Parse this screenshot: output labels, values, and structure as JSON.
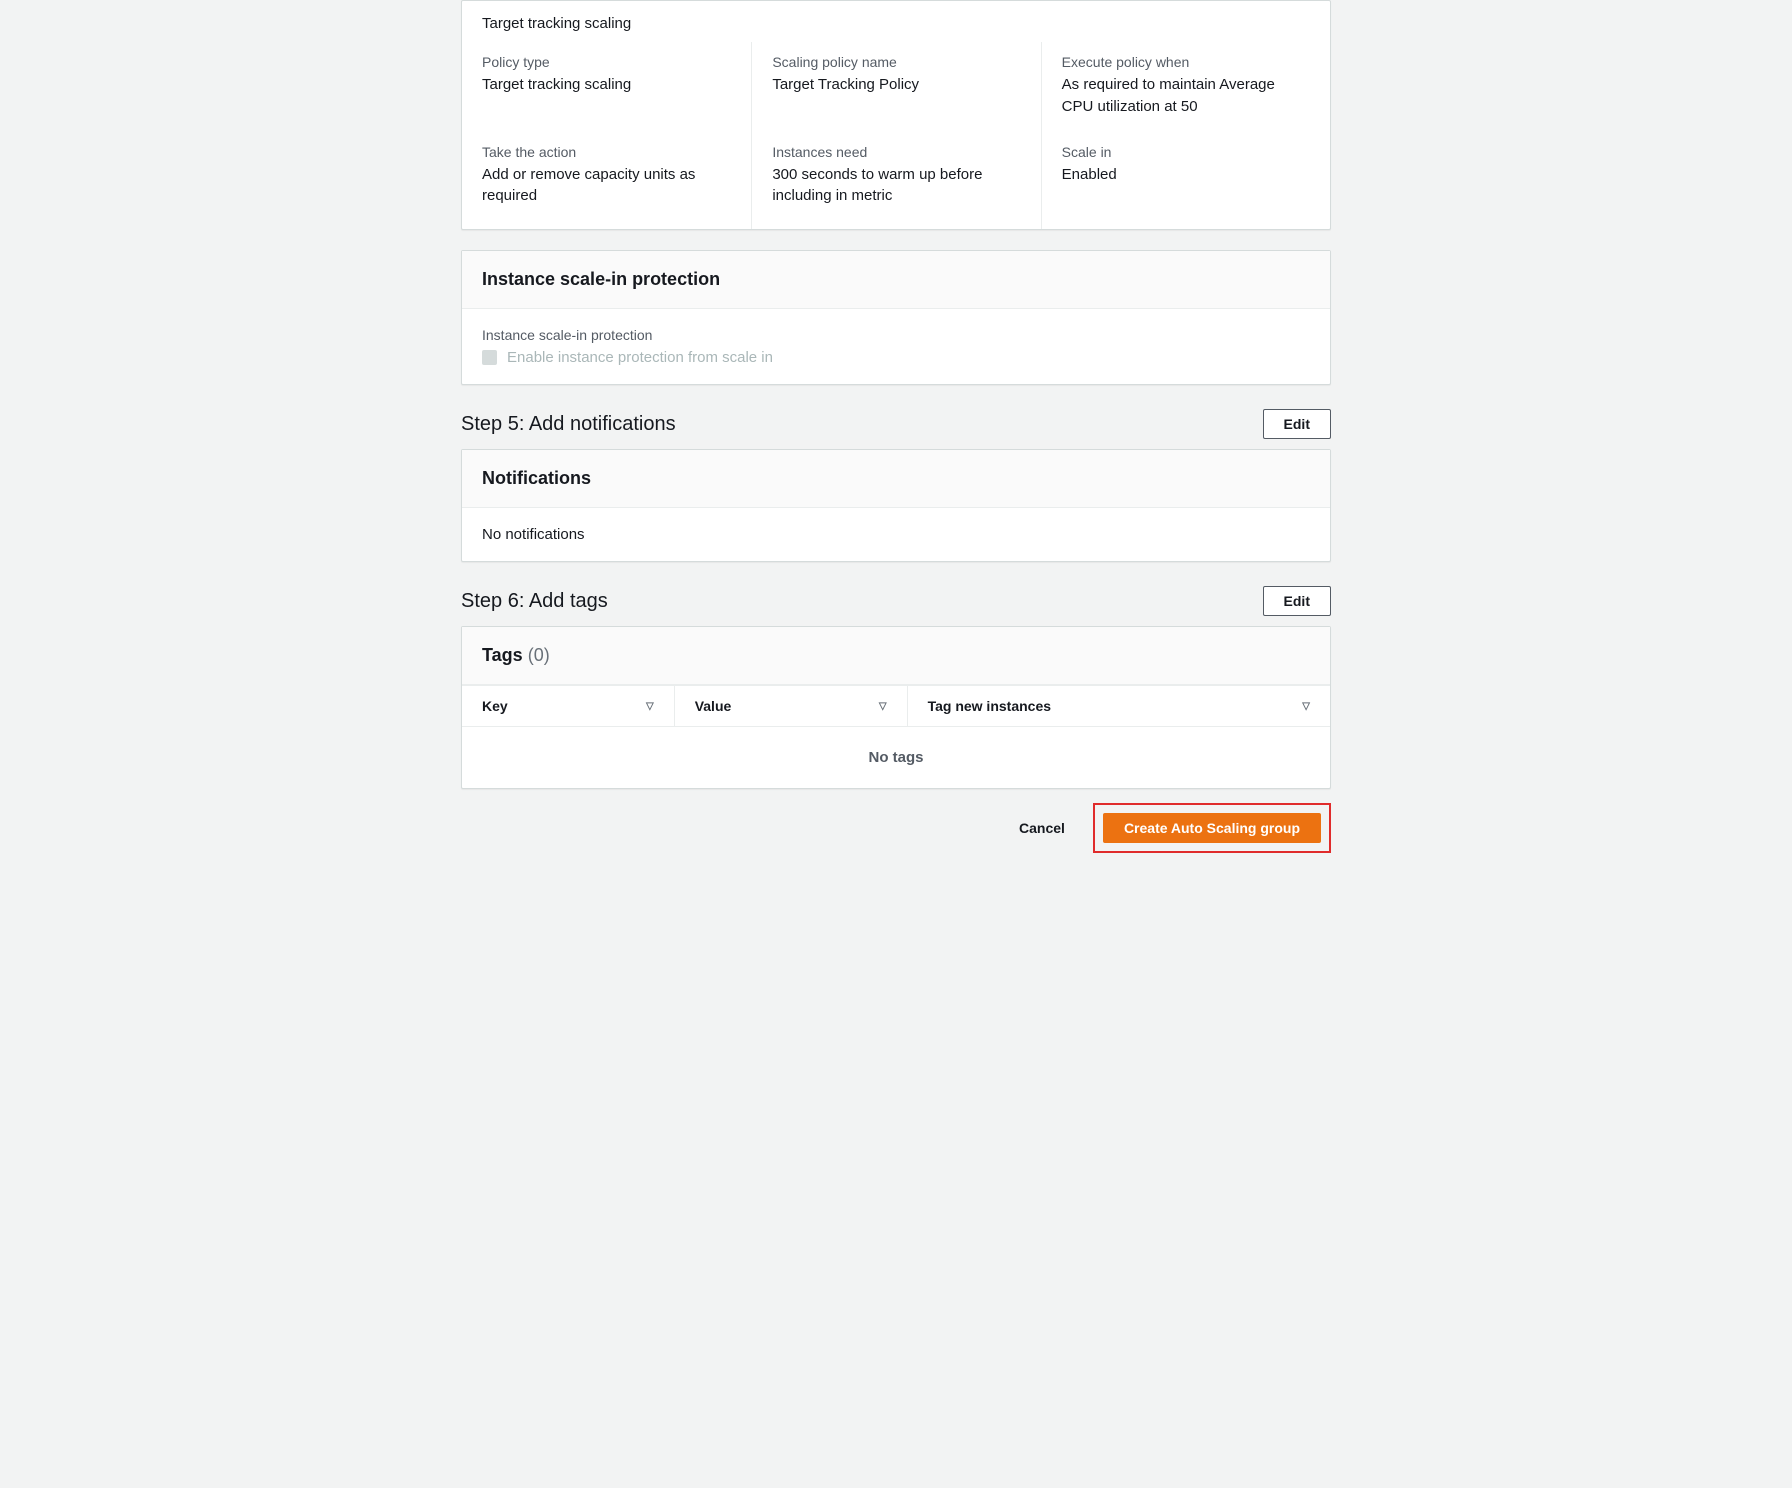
{
  "policy": {
    "title": "Target tracking scaling",
    "row1": {
      "policyType": {
        "label": "Policy type",
        "value": "Target tracking scaling"
      },
      "policyName": {
        "label": "Scaling policy name",
        "value": "Target Tracking Policy"
      },
      "executeWhen": {
        "label": "Execute policy when",
        "value": "As required to maintain Average CPU utilization at 50"
      }
    },
    "row2": {
      "takeAction": {
        "label": "Take the action",
        "value": "Add or remove capacity units as required"
      },
      "instancesNeed": {
        "label": "Instances need",
        "value": "300 seconds to warm up before including in metric"
      },
      "scaleIn": {
        "label": "Scale in",
        "value": "Enabled"
      }
    }
  },
  "scaleInProtection": {
    "title": "Instance scale-in protection",
    "subLabel": "Instance scale-in protection",
    "checkboxLabel": "Enable instance protection from scale in"
  },
  "step5": {
    "title": "Step 5: Add notifications",
    "editLabel": "Edit",
    "panelTitle": "Notifications",
    "emptyText": "No notifications"
  },
  "step6": {
    "title": "Step 6: Add tags",
    "editLabel": "Edit",
    "panelTitle": "Tags",
    "count": "(0)",
    "columns": {
      "key": "Key",
      "value": "Value",
      "tagNew": "Tag new instances"
    },
    "emptyText": "No tags"
  },
  "footer": {
    "cancel": "Cancel",
    "create": "Create Auto Scaling group"
  }
}
